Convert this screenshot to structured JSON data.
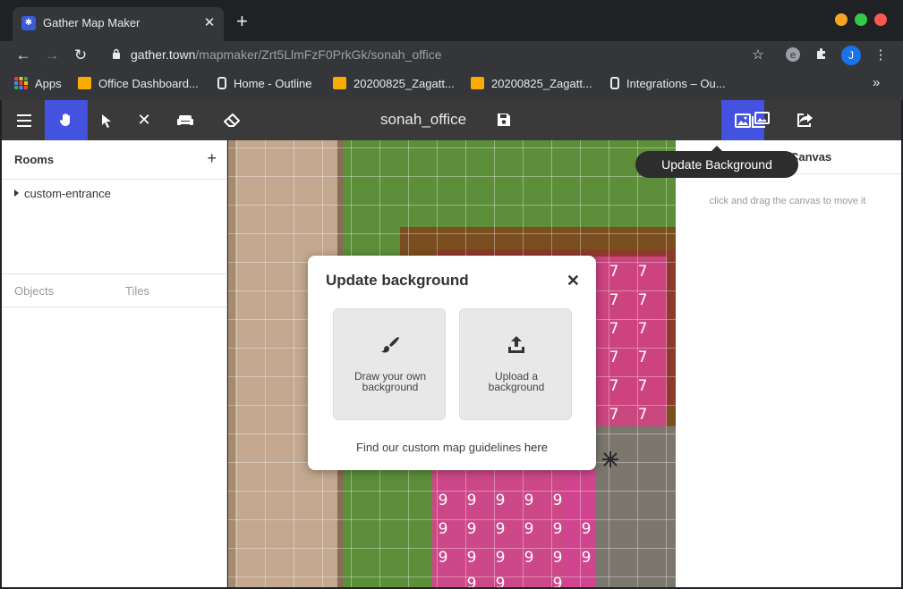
{
  "browser": {
    "tab_title": "Gather Map Maker",
    "tab_close": "✕",
    "new_tab": "+",
    "url_host": "gather.town",
    "url_path": "/mapmaker/Zrt5LlmFzF0PrkGk/sonah_office",
    "avatar_letter": "J",
    "bookmarks": [
      {
        "label": "Apps",
        "icon": "apps-grid-icon"
      },
      {
        "label": "Office Dashboard...",
        "icon": "folder-icon"
      },
      {
        "label": "Home - Outline",
        "icon": "outline-icon"
      },
      {
        "label": "20200825_Zagatt...",
        "icon": "folder-icon"
      },
      {
        "label": "20200825_Zagatt...",
        "icon": "folder-icon"
      },
      {
        "label": "Integrations – Ou...",
        "icon": "outline-icon"
      }
    ],
    "bookmarks_more": "»"
  },
  "app": {
    "map_name": "sonah_office",
    "tooltip": "Update Background"
  },
  "left_panel": {
    "rooms_title": "Rooms",
    "rooms_add": "+",
    "room": "custom-entrance",
    "tab_objects": "Objects",
    "tab_tiles": "Tiles"
  },
  "right_panel": {
    "title": "Canvas",
    "hint": "click and drag the canvas to move it"
  },
  "modal": {
    "title": "Update background",
    "close": "✕",
    "option_draw": "Draw your own background",
    "option_upload": "Upload a background",
    "footer_text": "Find our custom map guidelines ",
    "footer_link": "here"
  },
  "colors": {
    "accent": "#4353e0",
    "spawn_tiles": "#e0448f",
    "grass": "#5d8f3a"
  }
}
